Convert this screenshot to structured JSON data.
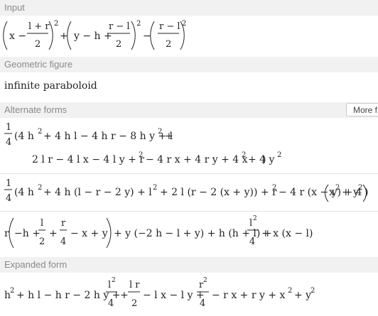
{
  "sections": {
    "input": "Input",
    "geometric_figure": "Geometric figure",
    "alternate_forms": "Alternate forms",
    "expanded_form": "Expanded form"
  },
  "more_button": "More f",
  "geometric_figure_value": "infinite paraboloid",
  "formulas": {
    "input": "(x - (l + r)/2)^2 + (y - h + (r - l)/2)^2 - ((r - l)/2)^2",
    "alternate_1": "1/4 (4 h^2 + 4 h l - 4 h r - 8 h y + l^2 + 2 l r - 4 l x - 4 l y + r^2 - 4 r x + 4 r y + 4 x^2 + 4 y^2)",
    "alternate_2": "1/4 (4 h^2 + 4 h (l - r - 2 y) + l^2 + 2 l (r - 2 (x + y)) + r^2 - 4 r (x - y) + 4 (x^2 + y^2))",
    "alternate_3": "r (-h + l/2 + r/4 - x + y) + y (-2 h - l + y) + h (h + l) + l^2/4 + x (x - l)",
    "expanded": "h^2 + h l - h r - 2 h y + l^2/4 + l r/2 - l x - l y + r^2/4 - r x + r y + x^2 + y^2"
  }
}
